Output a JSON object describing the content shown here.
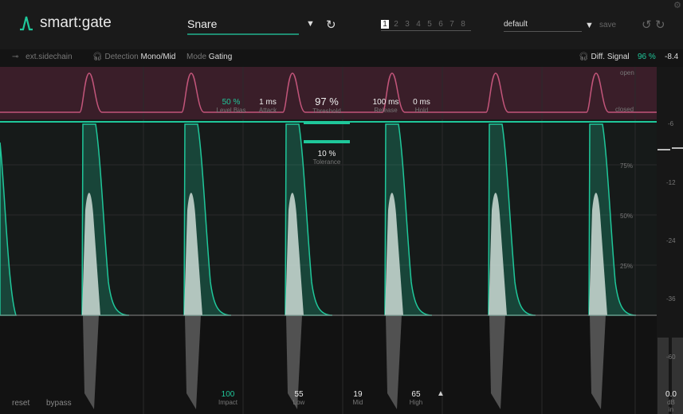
{
  "header": {
    "logo": "smart:gate",
    "preset": "Snare",
    "slots": [
      "1",
      "2",
      "3",
      "4",
      "5",
      "6",
      "7",
      "8"
    ],
    "active_slot": "1",
    "ab_preset": "default",
    "save": "save"
  },
  "subbar": {
    "sidechain": "ext.sidechain",
    "detection_label": "Detection",
    "detection_value": "Mono/Mid",
    "mode_label": "Mode",
    "mode_value": "Gating",
    "diff_label": "Diff. Signal",
    "diff_percent": "96 %",
    "diff_db": "-8.4"
  },
  "gate": {
    "open": "open",
    "closed": "closed",
    "level_bias": {
      "value": "50 %",
      "label": "Level Bias"
    },
    "attack": {
      "value": "1 ms",
      "label": "Attack"
    },
    "threshold": {
      "value": "97 %",
      "label": "Threshold"
    },
    "release": {
      "value": "100 ms",
      "label": "Release"
    },
    "hold": {
      "value": "0 ms",
      "label": "Hold"
    },
    "tolerance": {
      "value": "10 %",
      "label": "Tolerance"
    }
  },
  "percent_ticks": [
    "75%",
    "50%",
    "25%"
  ],
  "db_ticks": [
    "-6",
    "-12",
    "-24",
    "-36",
    "-60"
  ],
  "footer": {
    "reset": "reset",
    "bypass": "bypass",
    "impact": {
      "value": "100",
      "label": "Impact"
    },
    "low": {
      "value": "55",
      "label": "Low"
    },
    "mid": {
      "value": "19",
      "label": "Mid"
    },
    "high": {
      "value": "65",
      "label": "High"
    },
    "meter_value": "0.0",
    "meter_label": "dB in"
  },
  "colors": {
    "accent": "#1fc79a",
    "pink": "#c2557a"
  }
}
